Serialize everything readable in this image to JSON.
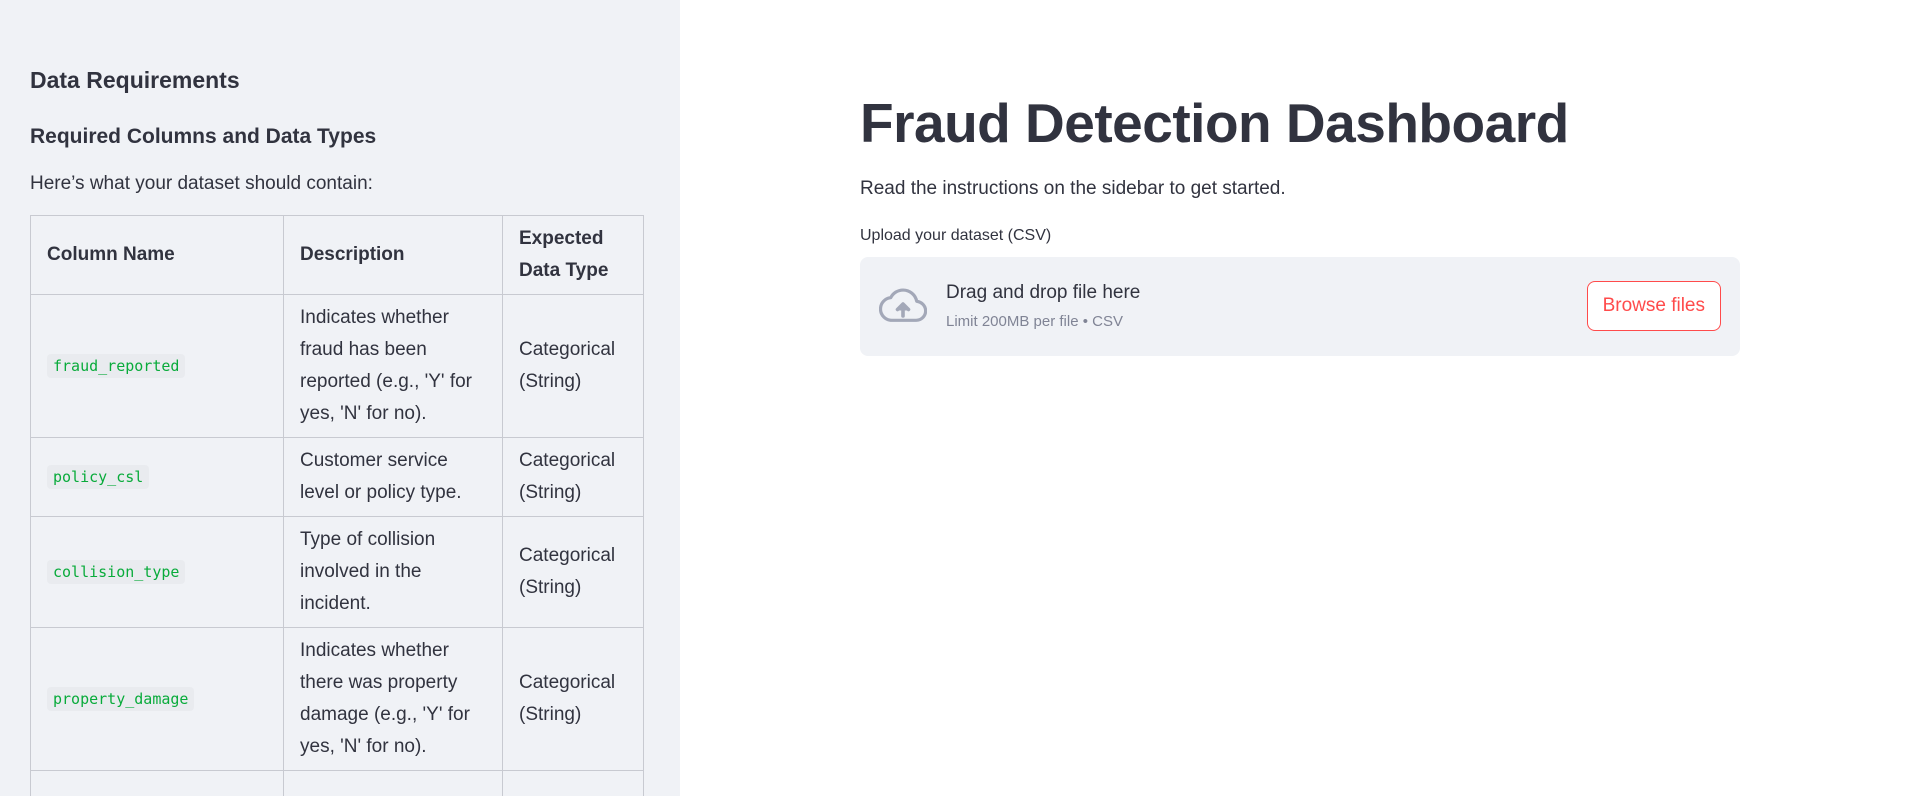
{
  "sidebar": {
    "heading": "Data Requirements",
    "subheading": "Required Columns and Data Types",
    "intro": "Here’s what your dataset should contain:",
    "table": {
      "headers": [
        "Column Name",
        "Description",
        "Expected Data Type"
      ],
      "rows": [
        {
          "column": "fraud_reported",
          "description": "Indicates whether fraud has been reported (e.g., 'Y' for yes, 'N' for no).",
          "type": "Categorical (String)"
        },
        {
          "column": "policy_csl",
          "description": "Customer service level or policy type.",
          "type": "Categorical (String)"
        },
        {
          "column": "collision_type",
          "description": "Type of collision involved in the incident.",
          "type": "Categorical (String)"
        },
        {
          "column": "property_damage",
          "description": "Indicates whether there was property damage (e.g., 'Y' for yes, 'N' for no).",
          "type": "Categorical (String)"
        }
      ]
    }
  },
  "main": {
    "title": "Fraud Detection Dashboard",
    "subtitle": "Read the instructions on the sidebar to get started.",
    "uploader": {
      "label": "Upload your dataset (CSV)",
      "drop_text": "Drag and drop file here",
      "limit_text": "Limit 200MB per file • CSV",
      "button_label": "Browse files",
      "icon": "cloud-upload-icon"
    }
  },
  "colors": {
    "sidebar_bg": "#f0f2f6",
    "text": "#31333f",
    "accent": "#ff4b4b",
    "code_green": "#09ab3b",
    "muted": "#808495"
  }
}
